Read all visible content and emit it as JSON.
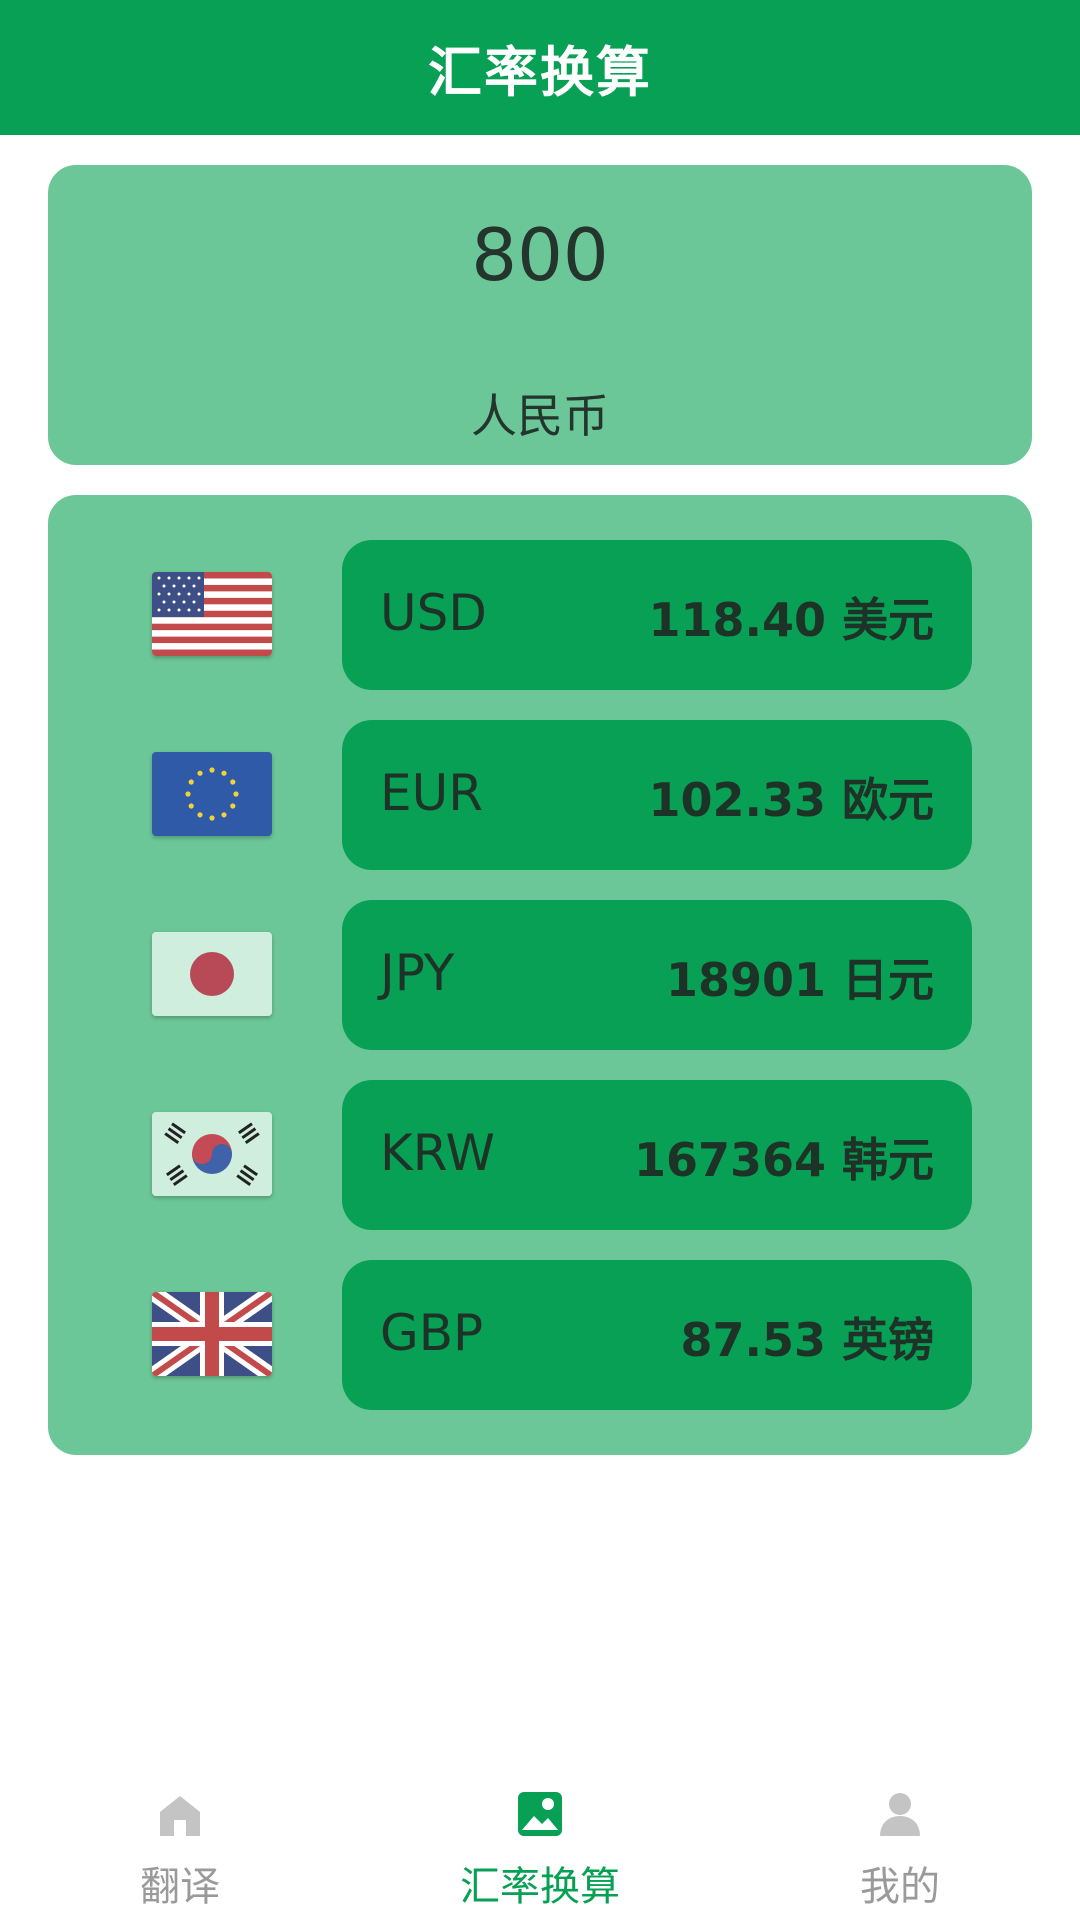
{
  "header": {
    "title": "汇率换算"
  },
  "amount_card": {
    "amount": "800",
    "currency": "人民币"
  },
  "rates": [
    {
      "code": "USD",
      "value": "118.40 美元",
      "flag_icon": "us-flag-icon"
    },
    {
      "code": "EUR",
      "value": "102.33 欧元",
      "flag_icon": "eu-flag-icon"
    },
    {
      "code": "JPY",
      "value": "18901 日元",
      "flag_icon": "jp-flag-icon"
    },
    {
      "code": "KRW",
      "value": "167364 韩元",
      "flag_icon": "kr-flag-icon"
    },
    {
      "code": "GBP",
      "value": "87.53 英镑",
      "flag_icon": "gb-flag-icon"
    }
  ],
  "bottom_nav": {
    "items": [
      {
        "label": "翻译",
        "icon": "home-icon",
        "active": false
      },
      {
        "label": "汇率换算",
        "icon": "image-icon",
        "active": true
      },
      {
        "label": "我的",
        "icon": "person-icon",
        "active": false
      }
    ]
  },
  "colors": {
    "primary": "#08a055",
    "card": "#6cc798",
    "pill": "#07a055",
    "inactive": "#9a9a9a"
  }
}
